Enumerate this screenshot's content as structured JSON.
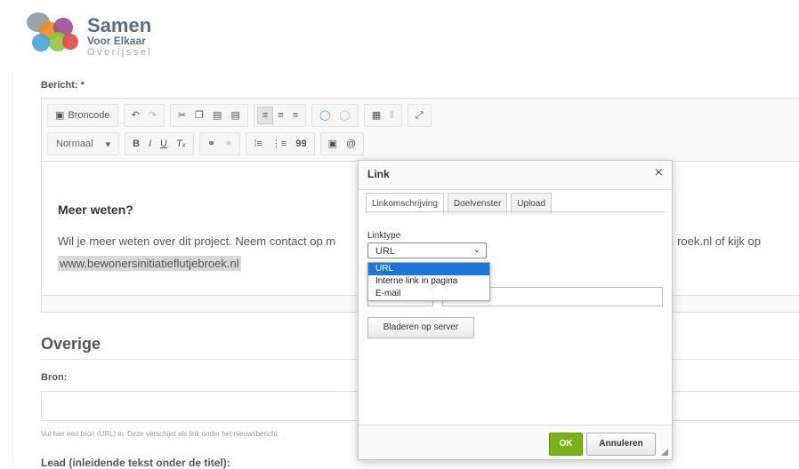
{
  "logo": {
    "line1": "Samen",
    "line2": "Voor Elkaar",
    "line3": "Overijssel"
  },
  "form": {
    "bericht_label": "Bericht: *",
    "overige_title": "Overige",
    "bron_label": "Bron:",
    "bron_hint": "Vul hier een bron (URL) in. Deze verschijnt als link onder het nieuwsbericht.",
    "lead_label": "Lead (inleidende tekst onder de titel):"
  },
  "toolbar": {
    "source_label": "Broncode",
    "format_label": "Normaal",
    "bold": "B",
    "italic": "I",
    "underline": "U",
    "quote": "99",
    "at": "@"
  },
  "editor": {
    "heading": "Meer weten?",
    "paragraph_start": "Wil je meer weten over dit project. Neem contact op m",
    "paragraph_end": "roek.nl of kijk op",
    "link_text": "www.bewonersinitiatieflutjebroek.nl"
  },
  "dialog": {
    "title": "Link",
    "close": "×",
    "tabs": [
      "Linkomschrijving",
      "Doelvenster",
      "Upload"
    ],
    "linktype_label": "Linktype",
    "linktype_value": "URL",
    "linktype_options": [
      "URL",
      "Interne link in pagina",
      "E-mail"
    ],
    "browse_label": "Bladeren op server",
    "ok_label": "OK",
    "cancel_label": "Annuleren"
  }
}
